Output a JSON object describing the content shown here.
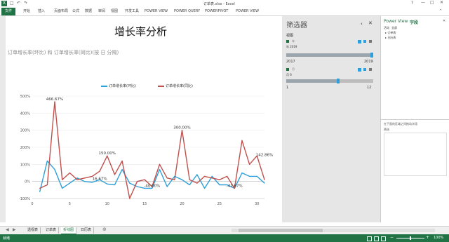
{
  "window": {
    "title": "订单表.xlsx - Excel"
  },
  "ribbon": {
    "tabs": [
      "文件",
      "开始",
      "插入",
      "页面布局",
      "公式",
      "数据",
      "审阅",
      "视图",
      "开发工具",
      "POWER VIEW",
      "POWER QUERY",
      "POWERPIVOT",
      "POWER VIEW"
    ]
  },
  "report": {
    "title": "增长率分析"
  },
  "chart_data": {
    "type": "line",
    "title": "订单增长率(环比) 和 订单增长率(同比)(按 日 分隔)",
    "legend_position": "top",
    "xlim": [
      0,
      31
    ],
    "ylim": [
      -100,
      500
    ],
    "x_ticks": [
      0,
      5,
      10,
      15,
      20,
      25,
      30
    ],
    "y_ticks": [
      -100,
      0,
      100,
      200,
      300,
      400,
      500
    ],
    "y_tick_labels": [
      "-100%",
      "0%",
      "100%",
      "200%",
      "300%",
      "400%",
      "500%"
    ],
    "grid": true,
    "series": [
      {
        "name": "订单增长率(环比)",
        "color": "#2e9fd8",
        "values": [
          [
            1,
            -60
          ],
          [
            2,
            120
          ],
          [
            3,
            70
          ],
          [
            4,
            -40
          ],
          [
            5,
            -10
          ],
          [
            6,
            20
          ],
          [
            7,
            0
          ],
          [
            8,
            -5
          ],
          [
            9,
            10
          ],
          [
            10,
            -15
          ],
          [
            11,
            -20
          ],
          [
            12,
            70
          ],
          [
            13,
            -10
          ],
          [
            14,
            -30
          ],
          [
            15,
            -40
          ],
          [
            16,
            -40
          ],
          [
            17,
            70
          ],
          [
            18,
            -30
          ],
          [
            19,
            30
          ],
          [
            20,
            10
          ],
          [
            21,
            -20
          ],
          [
            22,
            40
          ],
          [
            23,
            -40
          ],
          [
            24,
            30
          ],
          [
            25,
            -20
          ],
          [
            26,
            -20
          ],
          [
            27,
            -40
          ],
          [
            28,
            50
          ],
          [
            29,
            30
          ],
          [
            30,
            30
          ],
          [
            31,
            -10
          ]
        ]
      },
      {
        "name": "订单增长率(同比)",
        "color": "#c0504d",
        "values": [
          [
            1,
            -40
          ],
          [
            2,
            -20
          ],
          [
            3,
            466.67
          ],
          [
            4,
            10
          ],
          [
            5,
            50
          ],
          [
            6,
            10
          ],
          [
            7,
            20
          ],
          [
            8,
            30
          ],
          [
            9,
            60
          ],
          [
            10,
            150
          ],
          [
            11,
            40
          ],
          [
            12,
            120
          ],
          [
            13,
            -100
          ],
          [
            14,
            0
          ],
          [
            15,
            10
          ],
          [
            16,
            -30
          ],
          [
            17,
            100
          ],
          [
            18,
            20
          ],
          [
            19,
            10
          ],
          [
            20,
            300
          ],
          [
            21,
            10
          ],
          [
            22,
            -10
          ],
          [
            23,
            30
          ],
          [
            24,
            20
          ],
          [
            25,
            10
          ],
          [
            26,
            30
          ],
          [
            27,
            -40
          ],
          [
            28,
            240
          ],
          [
            29,
            100
          ],
          [
            30,
            150
          ],
          [
            31,
            10
          ]
        ]
      }
    ],
    "annotations": [
      {
        "x": 3,
        "y": 466.67,
        "text": "466.67%"
      },
      {
        "x": 10,
        "y": 150,
        "text": "150.00%"
      },
      {
        "x": 9,
        "y": 0,
        "text": "16.67%"
      },
      {
        "x": 16,
        "y": -40,
        "text": "-40.00%"
      },
      {
        "x": 20,
        "y": 300,
        "text": "300.00%"
      },
      {
        "x": 27,
        "y": -40,
        "text": "-41.67%"
      },
      {
        "x": 31,
        "y": 140,
        "text": "142.86%"
      }
    ]
  },
  "filters": {
    "title": "筛选器",
    "section": "视图",
    "filter1": {
      "label": "年",
      "value": "年 2019",
      "min_label": "2017",
      "max_label": "2019",
      "fill_fraction": 1.0
    },
    "filter2": {
      "label": "月",
      "value": "月 6",
      "min_label": "1",
      "max_label": "12",
      "fill_fraction": 0.6
    }
  },
  "fieldlist": {
    "title_prefix": "Power View",
    "title_suffix": "字段",
    "tab_active": "活动",
    "tab_all": "全部",
    "items": [
      "订单表",
      "日历表"
    ],
    "drop_hint": "在下面的区域之间拖动字段",
    "drop_area": "筛选"
  },
  "sheets": [
    "透视表",
    "订单表",
    "折线图",
    "日历表"
  ],
  "active_sheet": "折线图",
  "status": {
    "ready": "就绪",
    "zoom": "100%"
  }
}
